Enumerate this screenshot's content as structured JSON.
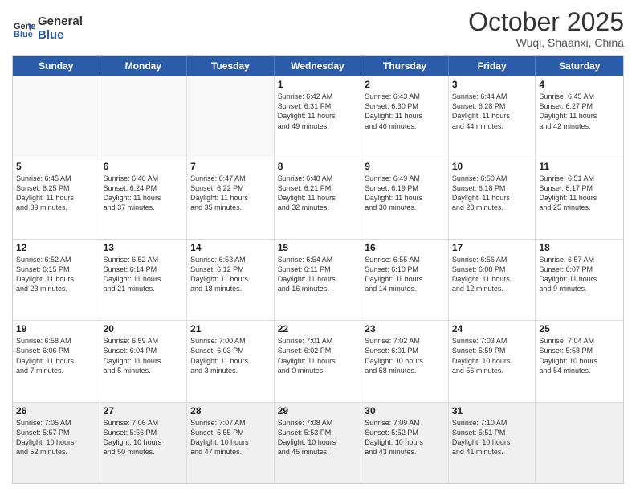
{
  "header": {
    "logo_general": "General",
    "logo_blue": "Blue",
    "month": "October 2025",
    "location": "Wuqi, Shaanxi, China"
  },
  "days_of_week": [
    "Sunday",
    "Monday",
    "Tuesday",
    "Wednesday",
    "Thursday",
    "Friday",
    "Saturday"
  ],
  "rows": [
    [
      {
        "day": "",
        "lines": []
      },
      {
        "day": "",
        "lines": []
      },
      {
        "day": "",
        "lines": []
      },
      {
        "day": "1",
        "lines": [
          "Sunrise: 6:42 AM",
          "Sunset: 6:31 PM",
          "Daylight: 11 hours",
          "and 49 minutes."
        ]
      },
      {
        "day": "2",
        "lines": [
          "Sunrise: 6:43 AM",
          "Sunset: 6:30 PM",
          "Daylight: 11 hours",
          "and 46 minutes."
        ]
      },
      {
        "day": "3",
        "lines": [
          "Sunrise: 6:44 AM",
          "Sunset: 6:28 PM",
          "Daylight: 11 hours",
          "and 44 minutes."
        ]
      },
      {
        "day": "4",
        "lines": [
          "Sunrise: 6:45 AM",
          "Sunset: 6:27 PM",
          "Daylight: 11 hours",
          "and 42 minutes."
        ]
      }
    ],
    [
      {
        "day": "5",
        "lines": [
          "Sunrise: 6:45 AM",
          "Sunset: 6:25 PM",
          "Daylight: 11 hours",
          "and 39 minutes."
        ]
      },
      {
        "day": "6",
        "lines": [
          "Sunrise: 6:46 AM",
          "Sunset: 6:24 PM",
          "Daylight: 11 hours",
          "and 37 minutes."
        ]
      },
      {
        "day": "7",
        "lines": [
          "Sunrise: 6:47 AM",
          "Sunset: 6:22 PM",
          "Daylight: 11 hours",
          "and 35 minutes."
        ]
      },
      {
        "day": "8",
        "lines": [
          "Sunrise: 6:48 AM",
          "Sunset: 6:21 PM",
          "Daylight: 11 hours",
          "and 32 minutes."
        ]
      },
      {
        "day": "9",
        "lines": [
          "Sunrise: 6:49 AM",
          "Sunset: 6:19 PM",
          "Daylight: 11 hours",
          "and 30 minutes."
        ]
      },
      {
        "day": "10",
        "lines": [
          "Sunrise: 6:50 AM",
          "Sunset: 6:18 PM",
          "Daylight: 11 hours",
          "and 28 minutes."
        ]
      },
      {
        "day": "11",
        "lines": [
          "Sunrise: 6:51 AM",
          "Sunset: 6:17 PM",
          "Daylight: 11 hours",
          "and 25 minutes."
        ]
      }
    ],
    [
      {
        "day": "12",
        "lines": [
          "Sunrise: 6:52 AM",
          "Sunset: 6:15 PM",
          "Daylight: 11 hours",
          "and 23 minutes."
        ]
      },
      {
        "day": "13",
        "lines": [
          "Sunrise: 6:52 AM",
          "Sunset: 6:14 PM",
          "Daylight: 11 hours",
          "and 21 minutes."
        ]
      },
      {
        "day": "14",
        "lines": [
          "Sunrise: 6:53 AM",
          "Sunset: 6:12 PM",
          "Daylight: 11 hours",
          "and 18 minutes."
        ]
      },
      {
        "day": "15",
        "lines": [
          "Sunrise: 6:54 AM",
          "Sunset: 6:11 PM",
          "Daylight: 11 hours",
          "and 16 minutes."
        ]
      },
      {
        "day": "16",
        "lines": [
          "Sunrise: 6:55 AM",
          "Sunset: 6:10 PM",
          "Daylight: 11 hours",
          "and 14 minutes."
        ]
      },
      {
        "day": "17",
        "lines": [
          "Sunrise: 6:56 AM",
          "Sunset: 6:08 PM",
          "Daylight: 11 hours",
          "and 12 minutes."
        ]
      },
      {
        "day": "18",
        "lines": [
          "Sunrise: 6:57 AM",
          "Sunset: 6:07 PM",
          "Daylight: 11 hours",
          "and 9 minutes."
        ]
      }
    ],
    [
      {
        "day": "19",
        "lines": [
          "Sunrise: 6:58 AM",
          "Sunset: 6:06 PM",
          "Daylight: 11 hours",
          "and 7 minutes."
        ]
      },
      {
        "day": "20",
        "lines": [
          "Sunrise: 6:59 AM",
          "Sunset: 6:04 PM",
          "Daylight: 11 hours",
          "and 5 minutes."
        ]
      },
      {
        "day": "21",
        "lines": [
          "Sunrise: 7:00 AM",
          "Sunset: 6:03 PM",
          "Daylight: 11 hours",
          "and 3 minutes."
        ]
      },
      {
        "day": "22",
        "lines": [
          "Sunrise: 7:01 AM",
          "Sunset: 6:02 PM",
          "Daylight: 11 hours",
          "and 0 minutes."
        ]
      },
      {
        "day": "23",
        "lines": [
          "Sunrise: 7:02 AM",
          "Sunset: 6:01 PM",
          "Daylight: 10 hours",
          "and 58 minutes."
        ]
      },
      {
        "day": "24",
        "lines": [
          "Sunrise: 7:03 AM",
          "Sunset: 5:59 PM",
          "Daylight: 10 hours",
          "and 56 minutes."
        ]
      },
      {
        "day": "25",
        "lines": [
          "Sunrise: 7:04 AM",
          "Sunset: 5:58 PM",
          "Daylight: 10 hours",
          "and 54 minutes."
        ]
      }
    ],
    [
      {
        "day": "26",
        "lines": [
          "Sunrise: 7:05 AM",
          "Sunset: 5:57 PM",
          "Daylight: 10 hours",
          "and 52 minutes."
        ]
      },
      {
        "day": "27",
        "lines": [
          "Sunrise: 7:06 AM",
          "Sunset: 5:56 PM",
          "Daylight: 10 hours",
          "and 50 minutes."
        ]
      },
      {
        "day": "28",
        "lines": [
          "Sunrise: 7:07 AM",
          "Sunset: 5:55 PM",
          "Daylight: 10 hours",
          "and 47 minutes."
        ]
      },
      {
        "day": "29",
        "lines": [
          "Sunrise: 7:08 AM",
          "Sunset: 5:53 PM",
          "Daylight: 10 hours",
          "and 45 minutes."
        ]
      },
      {
        "day": "30",
        "lines": [
          "Sunrise: 7:09 AM",
          "Sunset: 5:52 PM",
          "Daylight: 10 hours",
          "and 43 minutes."
        ]
      },
      {
        "day": "31",
        "lines": [
          "Sunrise: 7:10 AM",
          "Sunset: 5:51 PM",
          "Daylight: 10 hours",
          "and 41 minutes."
        ]
      },
      {
        "day": "",
        "lines": []
      }
    ]
  ]
}
